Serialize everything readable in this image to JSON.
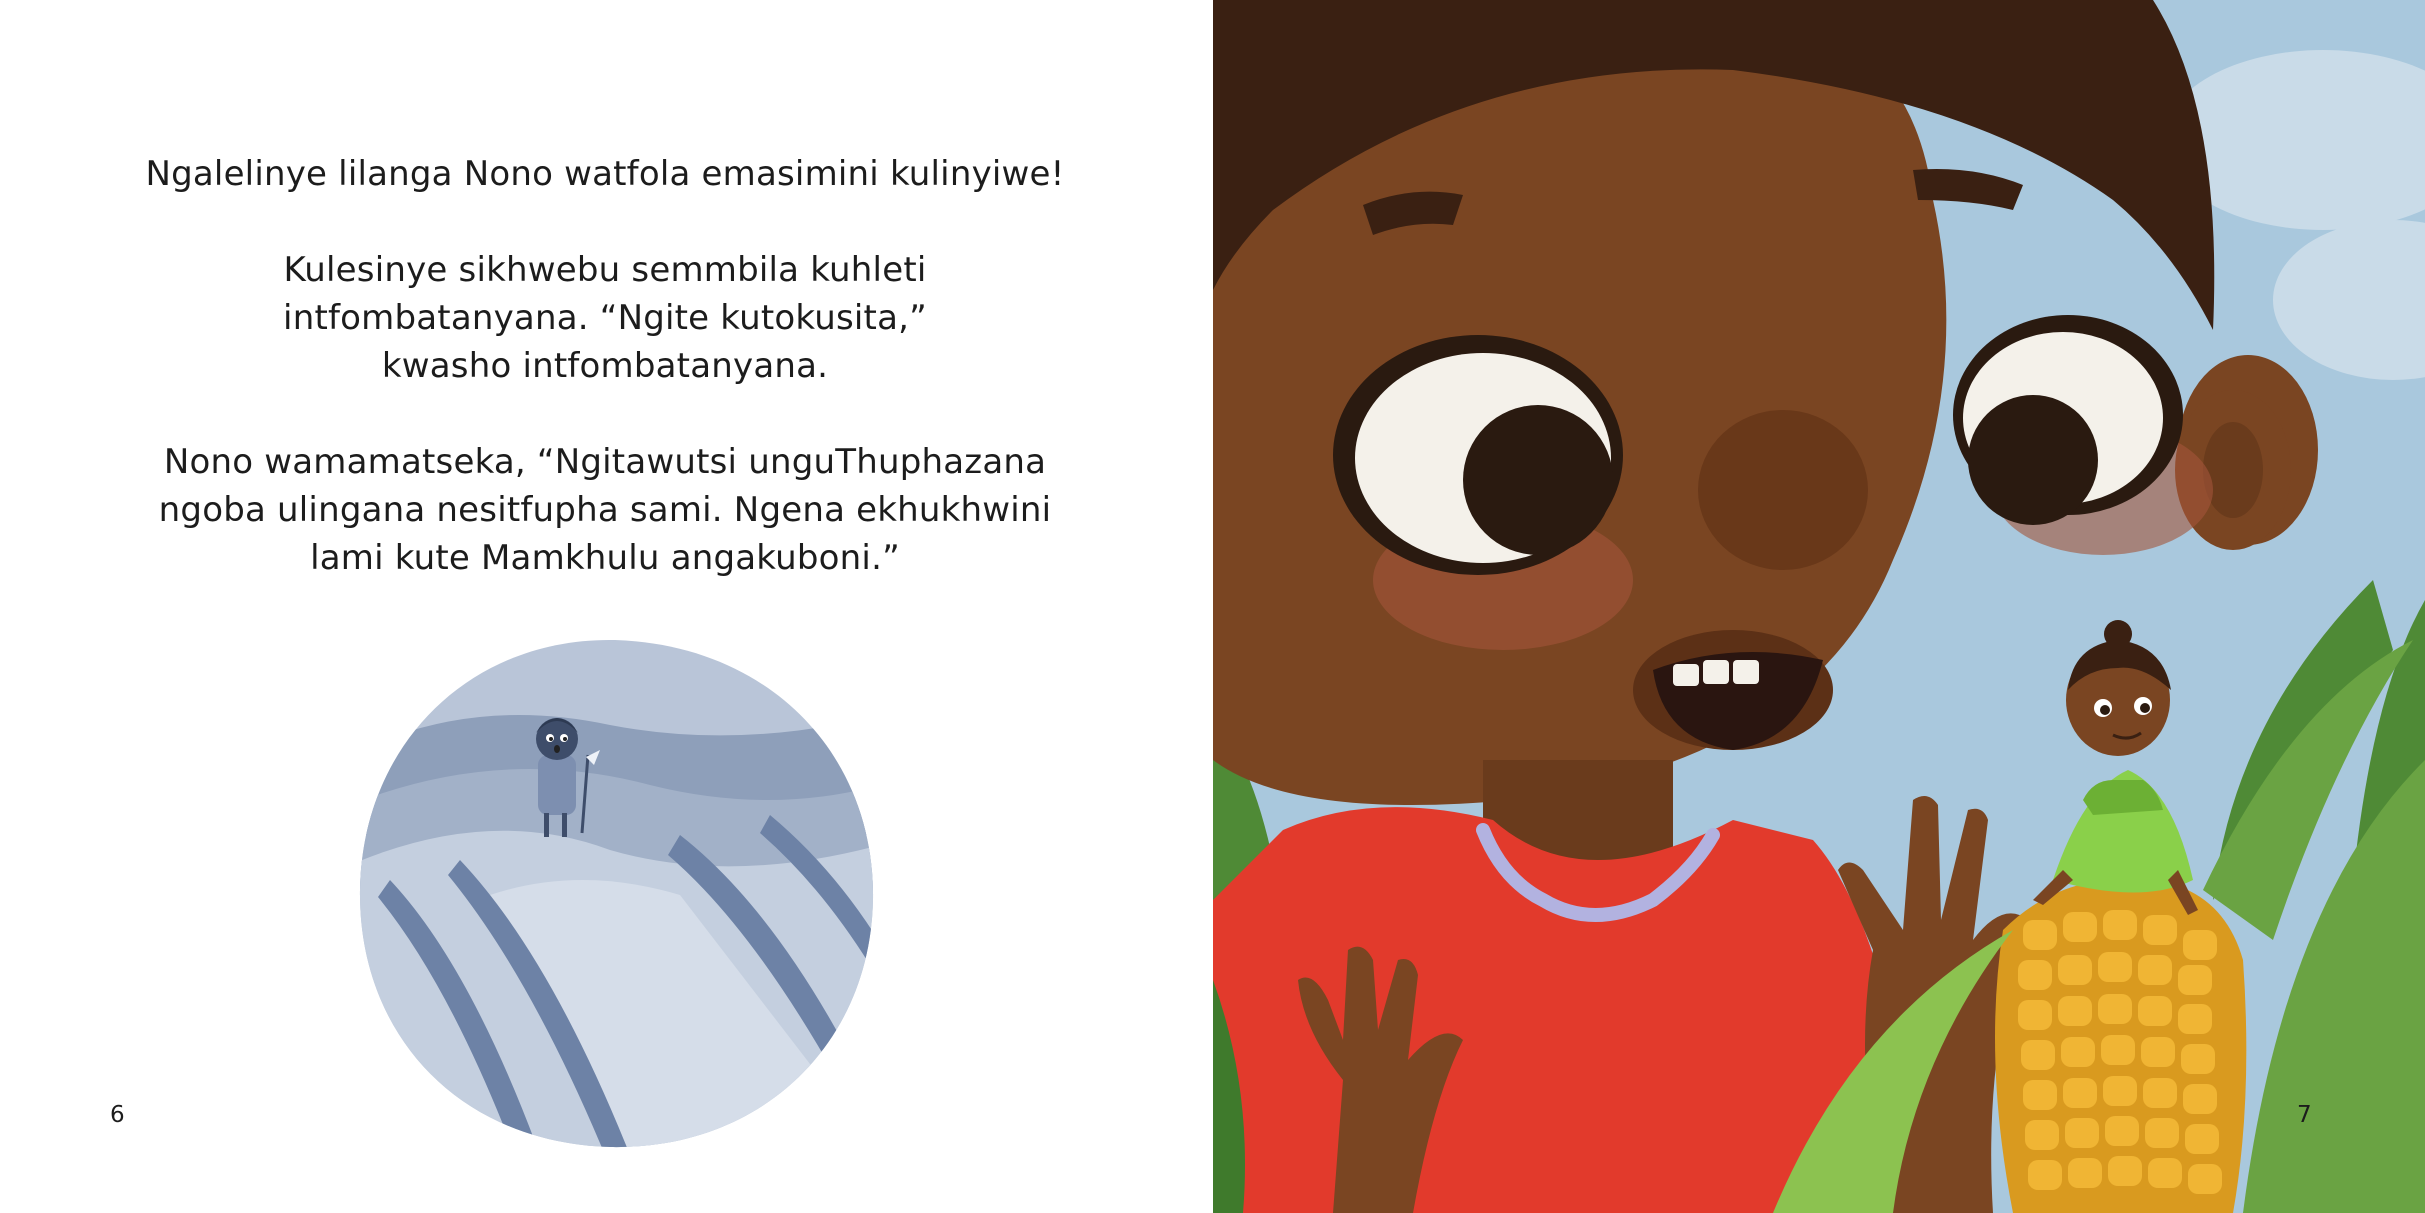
{
  "left_page": {
    "paragraphs": [
      [
        "Ngalelinye lilanga Nono watfola emasimini kulinyiwe!"
      ],
      [
        "Kulesinye sikhwebu semmbila kuhleti",
        "intfombatanyana. “Ngite kutokusita,”",
        "kwasho intfombatanyana."
      ],
      [
        "Nono wamamatseka, “Ngitawutsi unguThuphazana",
        "ngoba ulingana nesitfupha sami. Ngena ekhukhwini",
        "lami kute Mamkhulu angakuboni.”"
      ]
    ],
    "page_number": "6"
  },
  "right_page": {
    "page_number": "7"
  },
  "colors": {
    "skin": "#7a4522",
    "hair": "#3a2012",
    "dress": "#e23a2c",
    "corn": "#e8a92a",
    "leaf": "#5e9a3a",
    "sky": "#a9c8dd",
    "vignette": "#9fb0c8"
  }
}
